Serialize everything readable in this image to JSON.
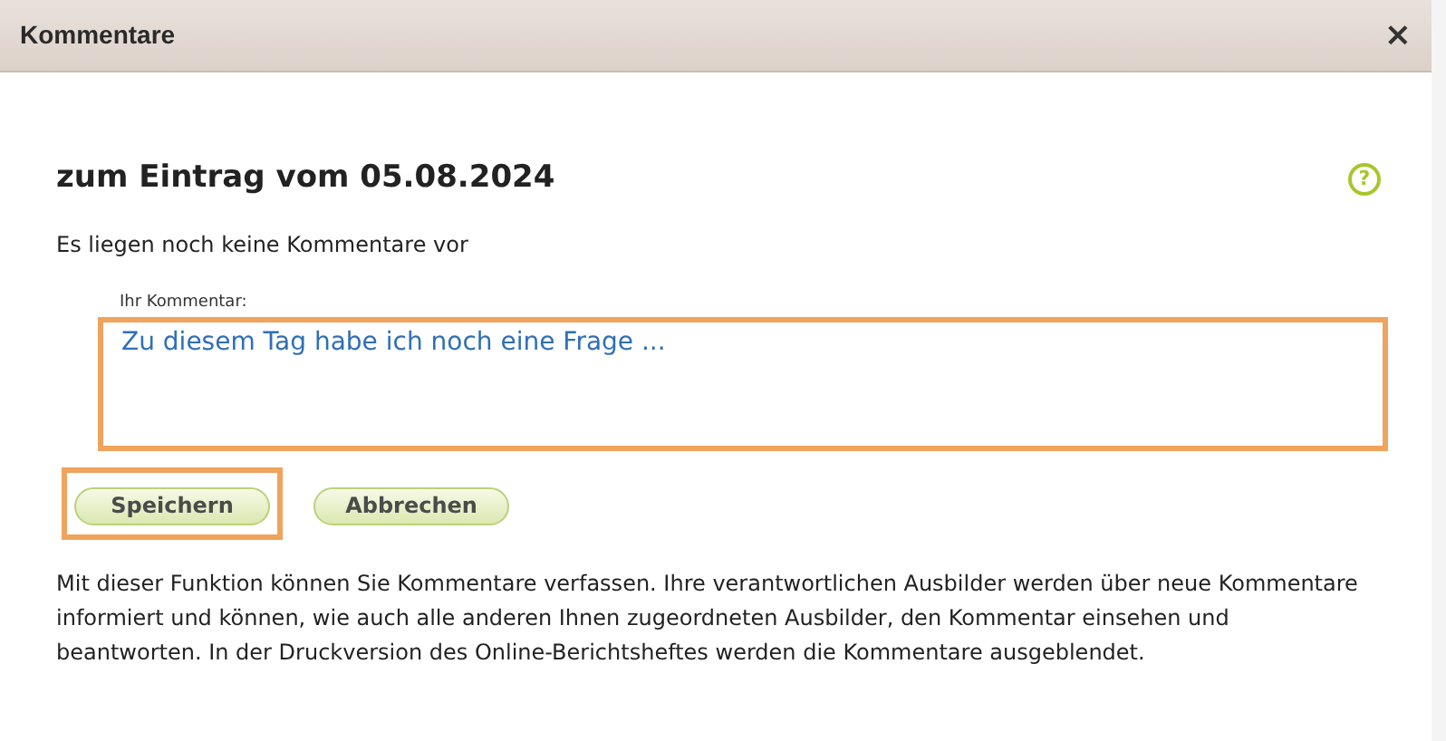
{
  "dialog": {
    "title": "Kommentare",
    "close": "×"
  },
  "heading": "zum Eintrag vom 05.08.2024",
  "help": "?",
  "status": "Es liegen noch keine Kommentare vor",
  "comment_field": {
    "label": "Ihr Kommentar:",
    "value": "Zu diesem Tag habe ich noch eine Frage ...",
    "highlighted": true
  },
  "buttons": [
    {
      "label": "Speichern",
      "highlighted": true
    },
    {
      "label": "Abbrechen",
      "highlighted": false
    }
  ],
  "info": "Mit dieser Funktion können Sie Kommentare verfassen. Ihre verantwortlichen Ausbilder werden über neue Kommentare informiert und können, wie auch alle anderen Ihnen zugeordneten Ausbilder, den Kommentar einsehen und beantworten. In der Druckversion des Online-Berichtsheftes werden die Kommentare ausgeblendet."
}
